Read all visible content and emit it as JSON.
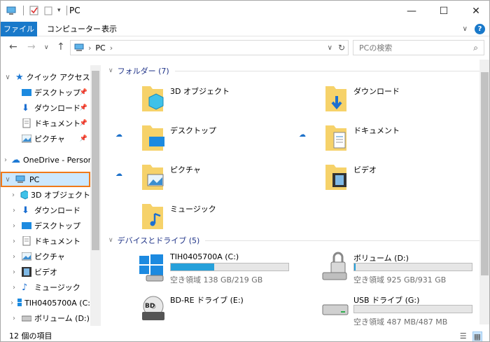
{
  "window": {
    "title": "PC"
  },
  "ribbon": {
    "tabs": [
      "ファイル",
      "コンピューター",
      "表示"
    ]
  },
  "address": {
    "path": [
      "PC"
    ]
  },
  "search": {
    "placeholder": "PCの検索"
  },
  "nav": {
    "quick_access": "クイック アクセス",
    "quick_items": [
      "デスクトップ",
      "ダウンロード",
      "ドキュメント",
      "ピクチャ"
    ],
    "onedrive": "OneDrive - Person",
    "pc": "PC",
    "pc_items": [
      "3D オブジェクト",
      "ダウンロード",
      "デスクトップ",
      "ドキュメント",
      "ピクチャ",
      "ビデオ",
      "ミュージック",
      "TIH0405700A (C:",
      "ボリューム (D:)"
    ]
  },
  "folders_group": {
    "label": "フォルダー (7)"
  },
  "folders": [
    {
      "name": "3D オブジェクト",
      "icon": "3d-objects-folder-icon"
    },
    {
      "name": "ダウンロード",
      "icon": "downloads-folder-icon"
    },
    {
      "name": "デスクトップ",
      "icon": "desktop-folder-icon"
    },
    {
      "name": "ドキュメント",
      "icon": "documents-folder-icon"
    },
    {
      "name": "ピクチャ",
      "icon": "pictures-folder-icon"
    },
    {
      "name": "ビデオ",
      "icon": "videos-folder-icon"
    },
    {
      "name": "ミュージック",
      "icon": "music-folder-icon"
    }
  ],
  "drives_group": {
    "label": "デバイスとドライブ (5)"
  },
  "drives": [
    {
      "name": "TIH0405700A (C:)",
      "free": "空き領域 138 GB/219 GB",
      "used_fraction": 0.37
    },
    {
      "name": "ボリューム (D:)",
      "free": "空き領域 925 GB/931 GB",
      "used_fraction": 0.01
    },
    {
      "name": "BD-RE ドライブ (E:)",
      "free": ""
    },
    {
      "name": "USB ドライブ (G:)",
      "free": "空き領域 487 MB/487 MB",
      "used_fraction": 0.0
    }
  ],
  "status": {
    "items": "12 個の項目"
  },
  "colors": {
    "accent": "#1979ca",
    "bar_fill": "#26a0da",
    "selection": "#cce8ff",
    "highlight_border": "#f07a1a"
  }
}
